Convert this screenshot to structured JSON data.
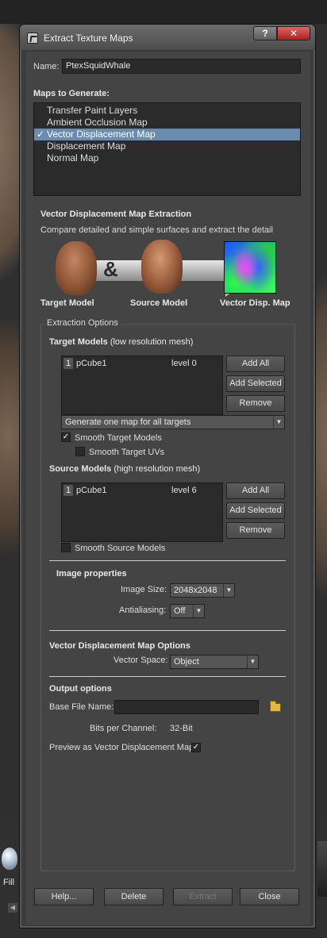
{
  "background": {
    "shelf_label": "Fill"
  },
  "dialog": {
    "title": "Extract Texture Maps",
    "help_glyph": "?",
    "close_glyph": "✕"
  },
  "name": {
    "label": "Name:",
    "value": "PtexSquidWhale"
  },
  "maps": {
    "heading": "Maps to Generate:",
    "items": [
      {
        "label": "Transfer Paint Layers",
        "checked": false,
        "selected": false
      },
      {
        "label": "Ambient Occlusion Map",
        "checked": false,
        "selected": false
      },
      {
        "label": "Vector Displacement Map",
        "checked": true,
        "selected": true
      },
      {
        "label": "Displacement Map",
        "checked": false,
        "selected": false
      },
      {
        "label": "Normal Map",
        "checked": false,
        "selected": false
      }
    ],
    "check_glyph": "✓"
  },
  "extraction": {
    "title": "Vector Displacement Map Extraction",
    "description": "Compare detailed and simple surfaces and extract the detail",
    "amp": "&",
    "target_label": "Target Model",
    "source_label": "Source Model",
    "result_label": "Vector Disp. Map"
  },
  "options": {
    "group_title": "Extraction Options",
    "target": {
      "heading": "Target Models",
      "subheading": "(low resolution mesh)",
      "rows": [
        {
          "index": "1",
          "name": "pCube1",
          "level": "level 0"
        }
      ],
      "add_all": "Add All",
      "add_selected": "Add Selected",
      "remove": "Remove",
      "mode": "Generate one map for all targets",
      "smooth_models": "Smooth Target Models",
      "smooth_models_checked": true,
      "smooth_uvs": "Smooth Target UVs",
      "smooth_uvs_checked": false
    },
    "source": {
      "heading": "Source Models",
      "subheading": "(high resolution mesh)",
      "rows": [
        {
          "index": "1",
          "name": "pCube1",
          "level": "level 6"
        }
      ],
      "add_all": "Add All",
      "add_selected": "Add Selected",
      "remove": "Remove",
      "smooth_models": "Smooth Source Models",
      "smooth_models_checked": false
    },
    "image": {
      "heading": "Image properties",
      "size_label": "Image Size:",
      "size_value": "2048x2048",
      "aa_label": "Antialiasing:",
      "aa_value": "Off"
    },
    "vdm": {
      "heading": "Vector Displacement Map Options",
      "space_label": "Vector Space:",
      "space_value": "Object"
    },
    "output": {
      "heading": "Output options",
      "base_label": "Base File Name:",
      "base_value": "",
      "bits_label": "Bits per Channel:",
      "bits_value": "32-Bit",
      "preview_label": "Preview as Vector Displacement Map",
      "preview_checked": true
    }
  },
  "footer": {
    "help": "Help...",
    "delete": "Delete",
    "extract": "Extract",
    "close": "Close"
  }
}
